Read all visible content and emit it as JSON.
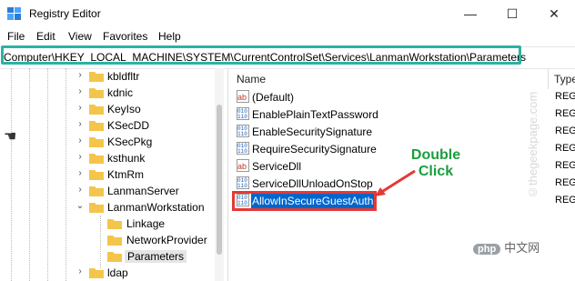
{
  "window": {
    "title": "Registry Editor",
    "minimize": "—",
    "maximize": "☐",
    "close": "✕"
  },
  "menu": [
    "File",
    "Edit",
    "View",
    "Favorites",
    "Help"
  ],
  "address": "Computer\\HKEY_LOCAL_MACHINE\\SYSTEM\\CurrentControlSet\\Services\\LanmanWorkstation\\Parameters",
  "tree": [
    {
      "label": "kbldfltr",
      "expander": "›"
    },
    {
      "label": "kdnic",
      "expander": "›"
    },
    {
      "label": "KeyIso",
      "expander": "›"
    },
    {
      "label": "KSecDD",
      "expander": "›"
    },
    {
      "label": "KSecPkg",
      "expander": "›"
    },
    {
      "label": "ksthunk",
      "expander": "›"
    },
    {
      "label": "KtmRm",
      "expander": "›"
    },
    {
      "label": "LanmanServer",
      "expander": "›"
    },
    {
      "label": "LanmanWorkstation",
      "expander": "⌄"
    },
    {
      "label": "Linkage",
      "expander": ""
    },
    {
      "label": "NetworkProvider",
      "expander": ""
    },
    {
      "label": "Parameters",
      "expander": ""
    },
    {
      "label": "ldap",
      "expander": "›"
    }
  ],
  "columns": {
    "name": "Name",
    "type": "Type"
  },
  "values": [
    {
      "name": "(Default)",
      "icon": "string-value-icon",
      "type": "REG"
    },
    {
      "name": "EnablePlainTextPassword",
      "icon": "binary-value-icon",
      "type": "REG"
    },
    {
      "name": "EnableSecuritySignature",
      "icon": "binary-value-icon",
      "type": "REG"
    },
    {
      "name": "RequireSecuritySignature",
      "icon": "binary-value-icon",
      "type": "REG"
    },
    {
      "name": "ServiceDll",
      "icon": "string-value-icon",
      "type": "REG"
    },
    {
      "name": "ServiceDllUnloadOnStop",
      "icon": "binary-value-icon",
      "type": "REG"
    },
    {
      "name": "AllowInSecureGuestAuth",
      "icon": "binary-value-icon",
      "type": "REG"
    }
  ],
  "annotation": {
    "line1": "Double",
    "line2": "Click"
  },
  "watermark": "©thegeekpage.com",
  "logo": {
    "badge": "php",
    "text": "中文网"
  },
  "colors": {
    "address_highlight": "#2bb3a3",
    "selection_border": "#e53935",
    "selection_fill": "#0066cc",
    "annotation": "#1b9e3e",
    "folder": "#f3c64b"
  }
}
